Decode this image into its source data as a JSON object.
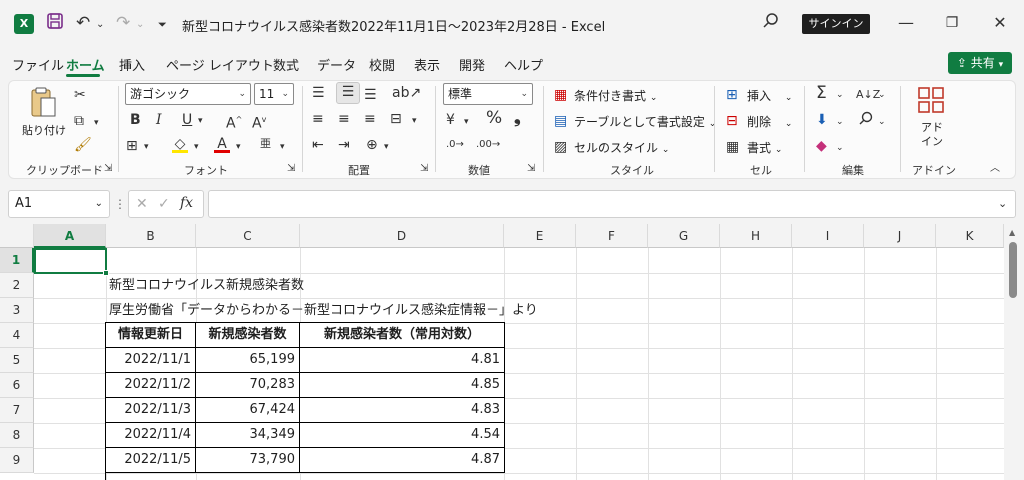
{
  "titlebar": {
    "title": "新型コロナウイルス感染者数2022年11月1日～2023年2月28日  -  Excel",
    "signin_label": "サインイン",
    "app_icon": "X"
  },
  "tabs": [
    {
      "label": "ファイル",
      "active": false
    },
    {
      "label": "ホーム",
      "active": true
    },
    {
      "label": "挿入",
      "active": false
    },
    {
      "label": "ページ レイアウト",
      "active": false
    },
    {
      "label": "数式",
      "active": false
    },
    {
      "label": "データ",
      "active": false
    },
    {
      "label": "校閲",
      "active": false
    },
    {
      "label": "表示",
      "active": false
    },
    {
      "label": "開発",
      "active": false
    },
    {
      "label": "ヘルプ",
      "active": false
    }
  ],
  "share_label": "共有",
  "ribbon": {
    "clipboard": {
      "paste_label": "貼り付け",
      "group_label": "クリップボード"
    },
    "font": {
      "font_name": "游ゴシック",
      "font_size": "11",
      "group_label": "フォント",
      "bold": "B",
      "italic": "I",
      "underline": "U"
    },
    "alignment": {
      "group_label": "配置"
    },
    "number": {
      "format": "標準",
      "group_label": "数値"
    },
    "styles": {
      "conditional": "条件付き書式",
      "table": "テーブルとして書式設定",
      "cell_style": "セルのスタイル",
      "group_label": "スタイル"
    },
    "cells": {
      "insert": "挿入",
      "delete": "削除",
      "format": "書式",
      "group_label": "セル"
    },
    "editing": {
      "group_label": "編集"
    },
    "addins": {
      "label": "アド\nイン",
      "label1": "アド",
      "label2": "イン",
      "group_label": "アドイン"
    }
  },
  "formula_bar": {
    "name_box": "A1",
    "formula": "",
    "fx_label": "fx"
  },
  "sheet": {
    "columns": [
      "A",
      "B",
      "C",
      "D",
      "E",
      "F",
      "G",
      "H",
      "I",
      "J",
      "K"
    ],
    "rows": [
      "1",
      "2",
      "3",
      "4",
      "5",
      "6",
      "7",
      "8",
      "9"
    ],
    "title": "新型コロナウイルス新規感染者数",
    "source": "厚生労働省「データからわかる－新型コロナウイルス感染症情報－」より",
    "table_headers": [
      "情報更新日",
      "新規感染者数",
      "新規感染者数（常用対数）"
    ],
    "table_rows": [
      [
        "2022/11/1",
        "65,199",
        "4.81"
      ],
      [
        "2022/11/2",
        "70,283",
        "4.85"
      ],
      [
        "2022/11/3",
        "67,424",
        "4.83"
      ],
      [
        "2022/11/4",
        "34,349",
        "4.54"
      ],
      [
        "2022/11/5",
        "73,790",
        "4.87"
      ]
    ]
  },
  "colors": {
    "accent": "#107c41"
  }
}
